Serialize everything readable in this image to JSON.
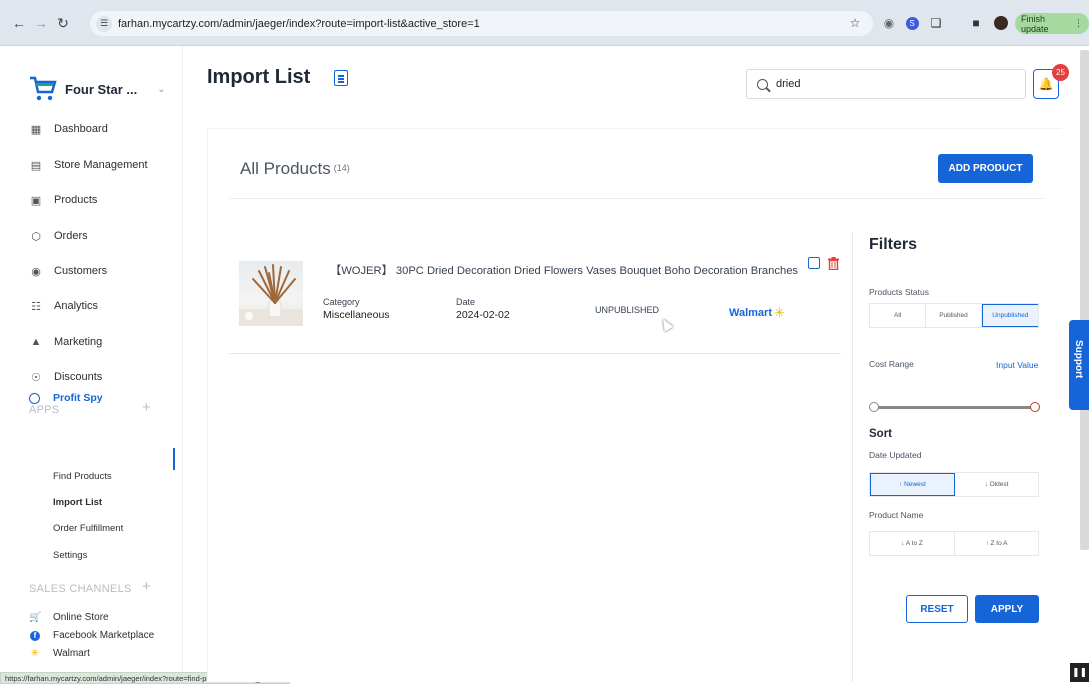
{
  "browser": {
    "url": "farhan.mycartzy.com/admin/jaeger/index?route=import-list&active_store=1",
    "finish_update": "Finish update",
    "status_url": "https://farhan.mycartzy.com/admin/jaeger/index?route=find-products&active_store=1"
  },
  "sidebar": {
    "store_name": "Four Star ...",
    "items": [
      {
        "label": "Dashboard",
        "icon": "dashboard-icon"
      },
      {
        "label": "Store Management",
        "icon": "store-icon"
      },
      {
        "label": "Products",
        "icon": "products-icon"
      },
      {
        "label": "Orders",
        "icon": "orders-icon"
      },
      {
        "label": "Customers",
        "icon": "customers-icon"
      },
      {
        "label": "Analytics",
        "icon": "analytics-icon"
      },
      {
        "label": "Marketing",
        "icon": "marketing-icon"
      },
      {
        "label": "Discounts",
        "icon": "discounts-icon"
      }
    ],
    "apps_title": "APPS",
    "app_name": "Profit Spy",
    "app_items": [
      "Find Products",
      "Import List",
      "Order Fulfillment",
      "Settings"
    ],
    "channels_title": "SALES CHANNELS",
    "channels": [
      "Online Store",
      "Facebook Marketplace",
      "Walmart"
    ]
  },
  "header": {
    "title": "Import List",
    "search_value": "dried",
    "notification_count": "25"
  },
  "main": {
    "heading": "All Products",
    "count": "(14)",
    "add_button": "ADD PRODUCT"
  },
  "product": {
    "title": "【WOJER】 30PC Dried Decoration Dried Flowers Vases Bouquet Boho Decoration Branches",
    "category_label": "Category",
    "category": "Miscellaneous",
    "date_label": "Date",
    "date": "2024-02-02",
    "status": "UNPUBLISHED",
    "marketplace": "Walmart"
  },
  "filters": {
    "title": "Filters",
    "status_label": "Products Status",
    "status_options": [
      "All",
      "Published",
      "Unpublished"
    ],
    "status_selected": "Unpublished",
    "cost_label": "Cost Range",
    "input_value": "Input Value",
    "sort_title": "Sort",
    "date_updated_label": "Date Updated",
    "date_options": [
      "↑ Newest",
      "↓ Oldest"
    ],
    "product_name_label": "Product Name",
    "name_options": [
      "↓ A to Z",
      "↑ Z to A"
    ],
    "reset": "RESET",
    "apply": "APPLY"
  },
  "support": "Support",
  "colors": {
    "accent": "#1565d8",
    "badge": "#e53e3e"
  }
}
